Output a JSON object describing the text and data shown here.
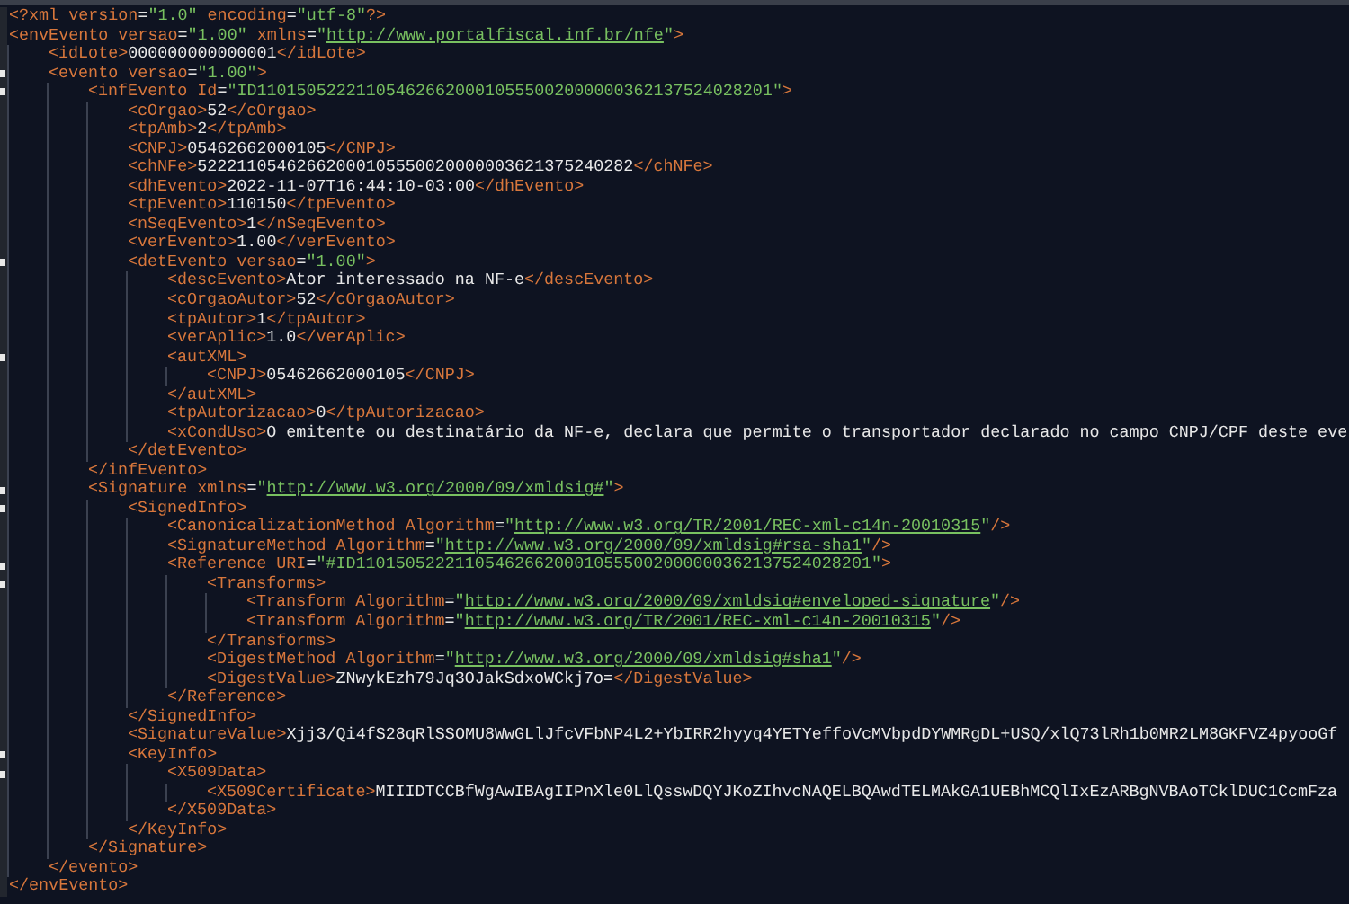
{
  "lines": [
    {
      "fold": false,
      "tokens": [
        {
          "kind": "tag",
          "text": "<?xml"
        },
        {
          "kind": "attr",
          "text": " version"
        },
        {
          "kind": "eq",
          "text": "="
        },
        {
          "kind": "str",
          "text": "\"1.0\""
        },
        {
          "kind": "attr",
          "text": " encoding"
        },
        {
          "kind": "eq",
          "text": "="
        },
        {
          "kind": "str",
          "text": "\"utf-8\""
        },
        {
          "kind": "tag",
          "text": "?>"
        }
      ]
    },
    {
      "fold": false,
      "tokens": [
        {
          "kind": "tag",
          "text": "<envEvento"
        },
        {
          "kind": "attr",
          "text": " versao"
        },
        {
          "kind": "eq",
          "text": "="
        },
        {
          "kind": "str",
          "text": "\"1.00\""
        },
        {
          "kind": "attr",
          "text": " xmlns"
        },
        {
          "kind": "eq",
          "text": "="
        },
        {
          "kind": "str",
          "text": "\""
        },
        {
          "kind": "link",
          "text": "http://www.portalfiscal.inf.br/nfe"
        },
        {
          "kind": "str",
          "text": "\""
        },
        {
          "kind": "tag",
          "text": ">"
        }
      ],
      "close": [
        {
          "kind": "tag",
          "text": "</envEvento>"
        }
      ],
      "children": [
        {
          "fold": false,
          "tokens": [
            {
              "kind": "tag",
              "text": "<idLote>"
            },
            {
              "kind": "text",
              "text": "000000000000001"
            },
            {
              "kind": "tag",
              "text": "</idLote>"
            }
          ]
        },
        {
          "fold": true,
          "tokens": [
            {
              "kind": "tag",
              "text": "<evento"
            },
            {
              "kind": "attr",
              "text": " versao"
            },
            {
              "kind": "eq",
              "text": "="
            },
            {
              "kind": "str",
              "text": "\"1.00\""
            },
            {
              "kind": "tag",
              "text": ">"
            }
          ],
          "close": [
            {
              "kind": "tag",
              "text": "</evento>"
            }
          ],
          "children": [
            {
              "fold": true,
              "tokens": [
                {
                  "kind": "tag",
                  "text": "<infEvento"
                },
                {
                  "kind": "attr",
                  "text": " Id"
                },
                {
                  "kind": "eq",
                  "text": "="
                },
                {
                  "kind": "str",
                  "text": "\"ID1101505222110546266200010555002000000362137524028201\""
                },
                {
                  "kind": "tag",
                  "text": ">"
                }
              ],
              "close": [
                {
                  "kind": "tag",
                  "text": "</infEvento>"
                }
              ],
              "children": [
                {
                  "fold": false,
                  "tokens": [
                    {
                      "kind": "tag",
                      "text": "<cOrgao>"
                    },
                    {
                      "kind": "text",
                      "text": "52"
                    },
                    {
                      "kind": "tag",
                      "text": "</cOrgao>"
                    }
                  ]
                },
                {
                  "fold": false,
                  "tokens": [
                    {
                      "kind": "tag",
                      "text": "<tpAmb>"
                    },
                    {
                      "kind": "text",
                      "text": "2"
                    },
                    {
                      "kind": "tag",
                      "text": "</tpAmb>"
                    }
                  ]
                },
                {
                  "fold": false,
                  "tokens": [
                    {
                      "kind": "tag",
                      "text": "<CNPJ>"
                    },
                    {
                      "kind": "text",
                      "text": "05462662000105"
                    },
                    {
                      "kind": "tag",
                      "text": "</CNPJ>"
                    }
                  ]
                },
                {
                  "fold": false,
                  "tokens": [
                    {
                      "kind": "tag",
                      "text": "<chNFe>"
                    },
                    {
                      "kind": "text",
                      "text": "52221105462662000105550020000003621375240282"
                    },
                    {
                      "kind": "tag",
                      "text": "</chNFe>"
                    }
                  ]
                },
                {
                  "fold": false,
                  "tokens": [
                    {
                      "kind": "tag",
                      "text": "<dhEvento>"
                    },
                    {
                      "kind": "text",
                      "text": "2022-11-07T16:44:10-03:00"
                    },
                    {
                      "kind": "tag",
                      "text": "</dhEvento>"
                    }
                  ]
                },
                {
                  "fold": false,
                  "tokens": [
                    {
                      "kind": "tag",
                      "text": "<tpEvento>"
                    },
                    {
                      "kind": "text",
                      "text": "110150"
                    },
                    {
                      "kind": "tag",
                      "text": "</tpEvento>"
                    }
                  ]
                },
                {
                  "fold": false,
                  "tokens": [
                    {
                      "kind": "tag",
                      "text": "<nSeqEvento>"
                    },
                    {
                      "kind": "text",
                      "text": "1"
                    },
                    {
                      "kind": "tag",
                      "text": "</nSeqEvento>"
                    }
                  ]
                },
                {
                  "fold": false,
                  "tokens": [
                    {
                      "kind": "tag",
                      "text": "<verEvento>"
                    },
                    {
                      "kind": "text",
                      "text": "1.00"
                    },
                    {
                      "kind": "tag",
                      "text": "</verEvento>"
                    }
                  ]
                },
                {
                  "fold": true,
                  "tokens": [
                    {
                      "kind": "tag",
                      "text": "<detEvento"
                    },
                    {
                      "kind": "attr",
                      "text": " versao"
                    },
                    {
                      "kind": "eq",
                      "text": "="
                    },
                    {
                      "kind": "str",
                      "text": "\"1.00\""
                    },
                    {
                      "kind": "tag",
                      "text": ">"
                    }
                  ],
                  "close": [
                    {
                      "kind": "tag",
                      "text": "</detEvento>"
                    }
                  ],
                  "children": [
                    {
                      "fold": false,
                      "tokens": [
                        {
                          "kind": "tag",
                          "text": "<descEvento>"
                        },
                        {
                          "kind": "text",
                          "text": "Ator interessado na NF-e"
                        },
                        {
                          "kind": "tag",
                          "text": "</descEvento>"
                        }
                      ]
                    },
                    {
                      "fold": false,
                      "tokens": [
                        {
                          "kind": "tag",
                          "text": "<cOrgaoAutor>"
                        },
                        {
                          "kind": "text",
                          "text": "52"
                        },
                        {
                          "kind": "tag",
                          "text": "</cOrgaoAutor>"
                        }
                      ]
                    },
                    {
                      "fold": false,
                      "tokens": [
                        {
                          "kind": "tag",
                          "text": "<tpAutor>"
                        },
                        {
                          "kind": "text",
                          "text": "1"
                        },
                        {
                          "kind": "tag",
                          "text": "</tpAutor>"
                        }
                      ]
                    },
                    {
                      "fold": false,
                      "tokens": [
                        {
                          "kind": "tag",
                          "text": "<verAplic>"
                        },
                        {
                          "kind": "text",
                          "text": "1.0"
                        },
                        {
                          "kind": "tag",
                          "text": "</verAplic>"
                        }
                      ]
                    },
                    {
                      "fold": true,
                      "tokens": [
                        {
                          "kind": "tag",
                          "text": "<autXML>"
                        }
                      ],
                      "close": [
                        {
                          "kind": "tag",
                          "text": "</autXML>"
                        }
                      ],
                      "children": [
                        {
                          "fold": false,
                          "tokens": [
                            {
                              "kind": "tag",
                              "text": "<CNPJ>"
                            },
                            {
                              "kind": "text",
                              "text": "05462662000105"
                            },
                            {
                              "kind": "tag",
                              "text": "</CNPJ>"
                            }
                          ]
                        }
                      ]
                    },
                    {
                      "fold": false,
                      "tokens": [
                        {
                          "kind": "tag",
                          "text": "<tpAutorizacao>"
                        },
                        {
                          "kind": "text",
                          "text": "0"
                        },
                        {
                          "kind": "tag",
                          "text": "</tpAutorizacao>"
                        }
                      ]
                    },
                    {
                      "fold": false,
                      "tokens": [
                        {
                          "kind": "tag",
                          "text": "<xCondUso>"
                        },
                        {
                          "kind": "text",
                          "text": "O emitente ou destinatário da NF-e, declara que permite o transportador declarado no campo CNPJ/CPF deste eve"
                        }
                      ]
                    }
                  ]
                }
              ]
            },
            {
              "fold": true,
              "tokens": [
                {
                  "kind": "tag",
                  "text": "<Signature"
                },
                {
                  "kind": "attr",
                  "text": " xmlns"
                },
                {
                  "kind": "eq",
                  "text": "="
                },
                {
                  "kind": "str",
                  "text": "\""
                },
                {
                  "kind": "link",
                  "text": "http://www.w3.org/2000/09/xmldsig#"
                },
                {
                  "kind": "str",
                  "text": "\""
                },
                {
                  "kind": "tag",
                  "text": ">"
                }
              ],
              "close": [
                {
                  "kind": "tag",
                  "text": "</Signature>"
                }
              ],
              "children": [
                {
                  "fold": true,
                  "tokens": [
                    {
                      "kind": "tag",
                      "text": "<SignedInfo>"
                    }
                  ],
                  "close": [
                    {
                      "kind": "tag",
                      "text": "</SignedInfo>"
                    }
                  ],
                  "children": [
                    {
                      "fold": false,
                      "tokens": [
                        {
                          "kind": "tag",
                          "text": "<CanonicalizationMethod"
                        },
                        {
                          "kind": "attr",
                          "text": " Algorithm"
                        },
                        {
                          "kind": "eq",
                          "text": "="
                        },
                        {
                          "kind": "str",
                          "text": "\""
                        },
                        {
                          "kind": "link",
                          "text": "http://www.w3.org/TR/2001/REC-xml-c14n-20010315"
                        },
                        {
                          "kind": "str",
                          "text": "\""
                        },
                        {
                          "kind": "tag",
                          "text": "/>"
                        }
                      ]
                    },
                    {
                      "fold": false,
                      "tokens": [
                        {
                          "kind": "tag",
                          "text": "<SignatureMethod"
                        },
                        {
                          "kind": "attr",
                          "text": " Algorithm"
                        },
                        {
                          "kind": "eq",
                          "text": "="
                        },
                        {
                          "kind": "str",
                          "text": "\""
                        },
                        {
                          "kind": "link",
                          "text": "http://www.w3.org/2000/09/xmldsig#rsa-sha1"
                        },
                        {
                          "kind": "str",
                          "text": "\""
                        },
                        {
                          "kind": "tag",
                          "text": "/>"
                        }
                      ]
                    },
                    {
                      "fold": true,
                      "tokens": [
                        {
                          "kind": "tag",
                          "text": "<Reference"
                        },
                        {
                          "kind": "attr",
                          "text": " URI"
                        },
                        {
                          "kind": "eq",
                          "text": "="
                        },
                        {
                          "kind": "str",
                          "text": "\"#ID1101505222110546266200010555002000000362137524028201\""
                        },
                        {
                          "kind": "tag",
                          "text": ">"
                        }
                      ],
                      "close": [
                        {
                          "kind": "tag",
                          "text": "</Reference>"
                        }
                      ],
                      "children": [
                        {
                          "fold": true,
                          "tokens": [
                            {
                              "kind": "tag",
                              "text": "<Transforms>"
                            }
                          ],
                          "close": [
                            {
                              "kind": "tag",
                              "text": "</Transforms>"
                            }
                          ],
                          "children": [
                            {
                              "fold": false,
                              "tokens": [
                                {
                                  "kind": "tag",
                                  "text": "<Transform"
                                },
                                {
                                  "kind": "attr",
                                  "text": " Algorithm"
                                },
                                {
                                  "kind": "eq",
                                  "text": "="
                                },
                                {
                                  "kind": "str",
                                  "text": "\""
                                },
                                {
                                  "kind": "link",
                                  "text": "http://www.w3.org/2000/09/xmldsig#enveloped-signature"
                                },
                                {
                                  "kind": "str",
                                  "text": "\""
                                },
                                {
                                  "kind": "tag",
                                  "text": "/>"
                                }
                              ]
                            },
                            {
                              "fold": false,
                              "tokens": [
                                {
                                  "kind": "tag",
                                  "text": "<Transform"
                                },
                                {
                                  "kind": "attr",
                                  "text": " Algorithm"
                                },
                                {
                                  "kind": "eq",
                                  "text": "="
                                },
                                {
                                  "kind": "str",
                                  "text": "\""
                                },
                                {
                                  "kind": "link",
                                  "text": "http://www.w3.org/TR/2001/REC-xml-c14n-20010315"
                                },
                                {
                                  "kind": "str",
                                  "text": "\""
                                },
                                {
                                  "kind": "tag",
                                  "text": "/>"
                                }
                              ]
                            }
                          ]
                        },
                        {
                          "fold": false,
                          "tokens": [
                            {
                              "kind": "tag",
                              "text": "<DigestMethod"
                            },
                            {
                              "kind": "attr",
                              "text": " Algorithm"
                            },
                            {
                              "kind": "eq",
                              "text": "="
                            },
                            {
                              "kind": "str",
                              "text": "\""
                            },
                            {
                              "kind": "link",
                              "text": "http://www.w3.org/2000/09/xmldsig#sha1"
                            },
                            {
                              "kind": "str",
                              "text": "\""
                            },
                            {
                              "kind": "tag",
                              "text": "/>"
                            }
                          ]
                        },
                        {
                          "fold": false,
                          "tokens": [
                            {
                              "kind": "tag",
                              "text": "<DigestValue>"
                            },
                            {
                              "kind": "text",
                              "text": "ZNwykEzh79Jq3OJakSdxoWCkj7o="
                            },
                            {
                              "kind": "tag",
                              "text": "</DigestValue>"
                            }
                          ]
                        }
                      ]
                    }
                  ]
                },
                {
                  "fold": false,
                  "tokens": [
                    {
                      "kind": "tag",
                      "text": "<SignatureValue>"
                    },
                    {
                      "kind": "text",
                      "text": "Xjj3/Qi4fS28qRlSSOMU8WwGLlJfcVFbNP4L2+YbIRR2hyyq4YETYeffoVcMVbpdDYWMRgDL+USQ/xlQ73lRh1b0MR2LM8GKFVZ4pyooGf"
                    }
                  ]
                },
                {
                  "fold": true,
                  "tokens": [
                    {
                      "kind": "tag",
                      "text": "<KeyInfo>"
                    }
                  ],
                  "close": [
                    {
                      "kind": "tag",
                      "text": "</KeyInfo>"
                    }
                  ],
                  "children": [
                    {
                      "fold": true,
                      "tokens": [
                        {
                          "kind": "tag",
                          "text": "<X509Data>"
                        }
                      ],
                      "close": [
                        {
                          "kind": "tag",
                          "text": "</X509Data>"
                        }
                      ],
                      "children": [
                        {
                          "fold": false,
                          "tokens": [
                            {
                              "kind": "tag",
                              "text": "<X509Certificate>"
                            },
                            {
                              "kind": "text",
                              "text": "MIIIDTCCBfWgAwIBAgIIPnXle0LlQsswDQYJKoZIhvcNAQELBQAwdTELMAkGA1UEBhMCQlIxEzARBgNVBAoTCklDUC1CcmFza"
                            }
                          ]
                        }
                      ]
                    }
                  ]
                }
              ]
            }
          ]
        }
      ]
    }
  ]
}
